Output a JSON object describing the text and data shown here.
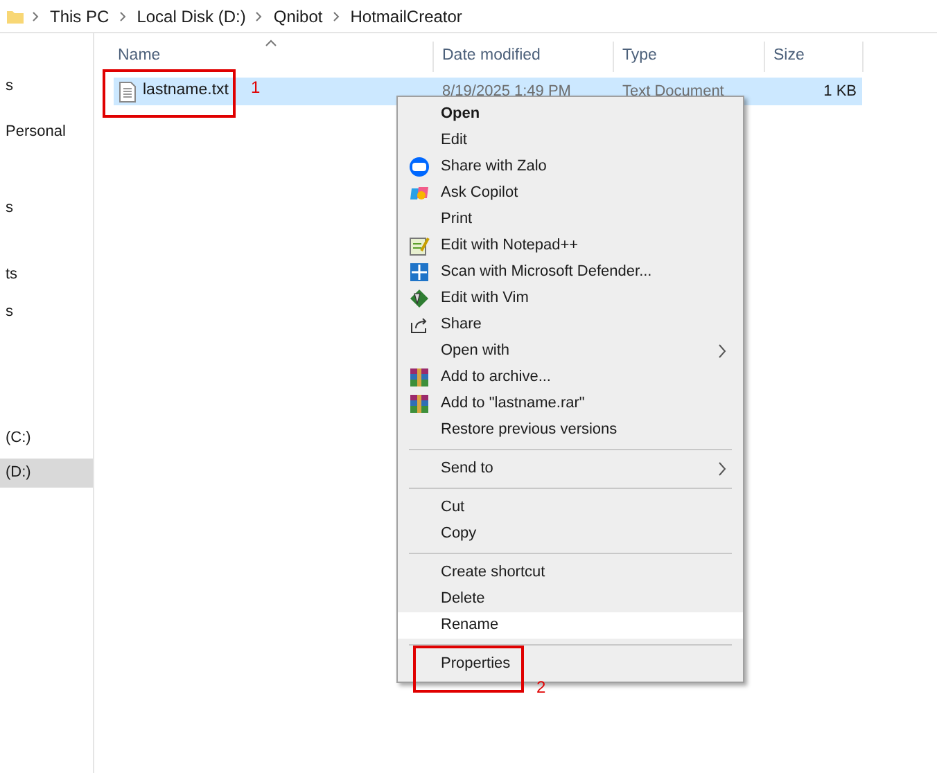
{
  "breadcrumb": [
    "This PC",
    "Local Disk (D:)",
    "Qnibot",
    "HotmailCreator"
  ],
  "sidebar": {
    "items": [
      {
        "label": "s",
        "selected": false
      },
      {
        "label": "Personal",
        "selected": false
      },
      {
        "label": "s",
        "selected": false
      },
      {
        "label": "ts",
        "selected": false
      },
      {
        "label": "s",
        "selected": false
      },
      {
        "label": "(C:)",
        "selected": false
      },
      {
        "label": "(D:)",
        "selected": true
      }
    ]
  },
  "table": {
    "columns": [
      "Name",
      "Date modified",
      "Type",
      "Size"
    ],
    "rows": [
      {
        "name": "lastname.txt",
        "date_modified": "8/19/2025 1:49 PM",
        "type": "Text Document",
        "size": "1 KB",
        "selected": true
      }
    ]
  },
  "context_menu": [
    {
      "kind": "item",
      "label": "Open",
      "default": true,
      "highlighted": false
    },
    {
      "kind": "item",
      "label": "Edit",
      "highlighted": false
    },
    {
      "kind": "item",
      "label": "Share with Zalo",
      "highlighted": false
    },
    {
      "kind": "item",
      "label": "Ask Copilot",
      "highlighted": false
    },
    {
      "kind": "item",
      "label": "Print",
      "highlighted": false
    },
    {
      "kind": "item",
      "label": "Edit with Notepad++",
      "highlighted": false
    },
    {
      "kind": "item",
      "label": "Scan with Microsoft Defender...",
      "highlighted": false
    },
    {
      "kind": "item",
      "label": "Edit with Vim",
      "highlighted": false
    },
    {
      "kind": "item",
      "label": "Share",
      "highlighted": false
    },
    {
      "kind": "item",
      "label": "Open with",
      "submenu": true,
      "highlighted": false
    },
    {
      "kind": "item",
      "label": "Add to archive...",
      "highlighted": false
    },
    {
      "kind": "item",
      "label": "Add to \"lastname.rar\"",
      "highlighted": false
    },
    {
      "kind": "item",
      "label": "Restore previous versions",
      "highlighted": false
    },
    {
      "kind": "separator"
    },
    {
      "kind": "item",
      "label": "Send to",
      "submenu": true,
      "highlighted": false
    },
    {
      "kind": "separator"
    },
    {
      "kind": "item",
      "label": "Cut",
      "highlighted": false
    },
    {
      "kind": "item",
      "label": "Copy",
      "highlighted": false
    },
    {
      "kind": "separator"
    },
    {
      "kind": "item",
      "label": "Create shortcut",
      "highlighted": false
    },
    {
      "kind": "item",
      "label": "Delete",
      "highlighted": false
    },
    {
      "kind": "item",
      "label": "Rename",
      "highlighted": true
    },
    {
      "kind": "separator"
    },
    {
      "kind": "item",
      "label": "Properties",
      "highlighted": false
    }
  ],
  "annotations": [
    {
      "label": "1"
    },
    {
      "label": "2"
    }
  ]
}
